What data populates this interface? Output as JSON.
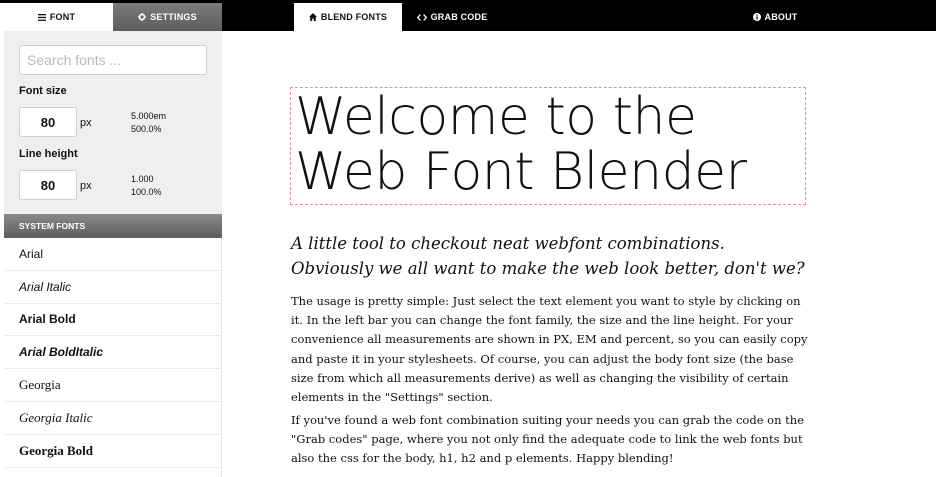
{
  "tabs": {
    "font": {
      "label": "FONT",
      "icon": "list-icon"
    },
    "settings": {
      "label": "SETTINGS",
      "icon": "gear-icon"
    },
    "blend": {
      "label": "BLEND FONTS",
      "icon": "home-icon"
    },
    "grab": {
      "label": "GRAB CODE",
      "icon": "code-icon"
    },
    "about": {
      "label": "ABOUT",
      "icon": "info-icon"
    }
  },
  "sidebar": {
    "search_placeholder": "Search fonts ...",
    "font_size": {
      "label": "Font size",
      "value": "80",
      "unit": "px",
      "em": "5.000em",
      "percent": "500.0%"
    },
    "line_height": {
      "label": "Line height",
      "value": "80",
      "unit": "px",
      "em": "1.000",
      "percent": "100.0%"
    },
    "system_fonts_header": "SYSTEM FONTS",
    "fonts": [
      {
        "label": "Arial"
      },
      {
        "label": "Arial Italic"
      },
      {
        "label": "Arial Bold"
      },
      {
        "label": "Arial BoldItalic"
      },
      {
        "label": "Georgia"
      },
      {
        "label": "Georgia Italic"
      },
      {
        "label": "Georgia Bold"
      }
    ]
  },
  "main": {
    "h1": "Welcome to the Web Font Blender",
    "h2": "A little tool to checkout neat webfont combinations. Obviously we all want to make the web look better, don't we?",
    "p1": "The usage is pretty simple: Just select the text element you want to style by clicking on it. In the left bar you can change the font family, the size and the line height. For your convenience all measurements are shown in PX, EM and percent, so you can easily copy and paste it in your stylesheets. Of course, you can adjust the body font size (the base size from which all measurements derive) as well as changing the visibility of certain elements in the \"Settings\" section.",
    "p2": "If you've found a web font combination suiting your needs you can grab the code on the \"Grab codes\" page, where you not only find the adequate code to link the web fonts but also the css for the body, h1, h2 and p elements. Happy blending!"
  },
  "colors": {
    "topbar": "#000000",
    "sidebar_bg": "#efefef",
    "h1_outline": "#e08ab0"
  }
}
